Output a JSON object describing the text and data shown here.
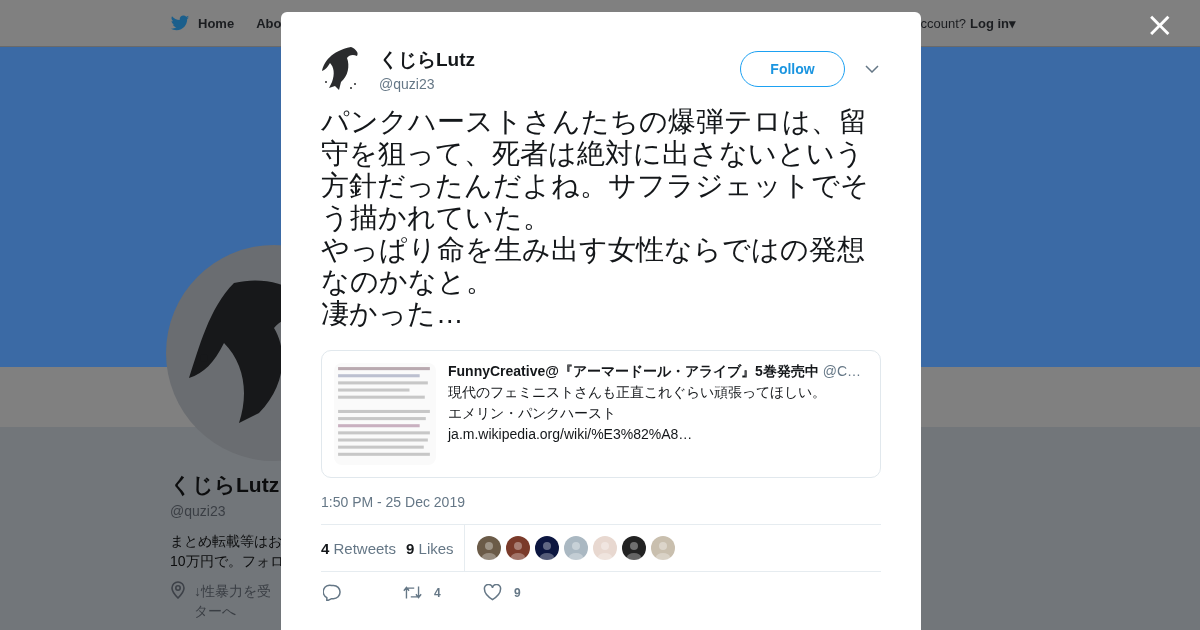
{
  "background_page": {
    "nav": {
      "items": [
        "Home",
        "Abo"
      ],
      "account_prompt": "ccount?",
      "login": "Log in",
      "login_caret": "▾"
    },
    "profile": {
      "name": "くじらLutz",
      "handle": "@quzi23",
      "bio": [
        "まとめ転載等はお",
        "10万円で。フォロ"
      ],
      "location": [
        "↓性暴力を受",
        "ターへ"
      ]
    }
  },
  "modal": {
    "close": "×",
    "tweet": {
      "author": {
        "name": "くじらLutz",
        "handle": "@quzi23"
      },
      "follow": "Follow",
      "text": [
        "パンクハーストさんたちの爆弾テロは、留守を狙って、死者は絶対に出さないという方針だったんだよね。サフラジェットでそう描かれていた。",
        "やっぱり命を生み出す女性ならではの発想なのかなと。",
        "凄かった…"
      ],
      "quoted": {
        "name": "FunnyCreative@『アーマードール・アライブ』5巻発売中",
        "handle": "@C…",
        "text": "現代のフェミニストさんも正直これぐらい頑張ってほしい。",
        "card_title": "エメリン・パンクハースト",
        "card_url": "ja.m.wikipedia.org/wiki/%E3%82%A8…"
      },
      "time": "1:50 PM - 25 Dec 2019",
      "stats": [
        {
          "count": "4",
          "label": "Retweets"
        },
        {
          "count": "9",
          "label": "Likes"
        }
      ],
      "liked_by": [
        {
          "color": "#6b5b48"
        },
        {
          "color": "#7a3a2a"
        },
        {
          "color": "#0c1640"
        },
        {
          "color": "#aab8c2"
        },
        {
          "color": "#e8d8d0"
        },
        {
          "color": "#222222"
        },
        {
          "color": "#c9bfae"
        }
      ],
      "actions": [
        {
          "kind": "reply"
        },
        {
          "kind": "retweet",
          "count": "4"
        },
        {
          "kind": "like",
          "count": "9"
        }
      ]
    }
  }
}
